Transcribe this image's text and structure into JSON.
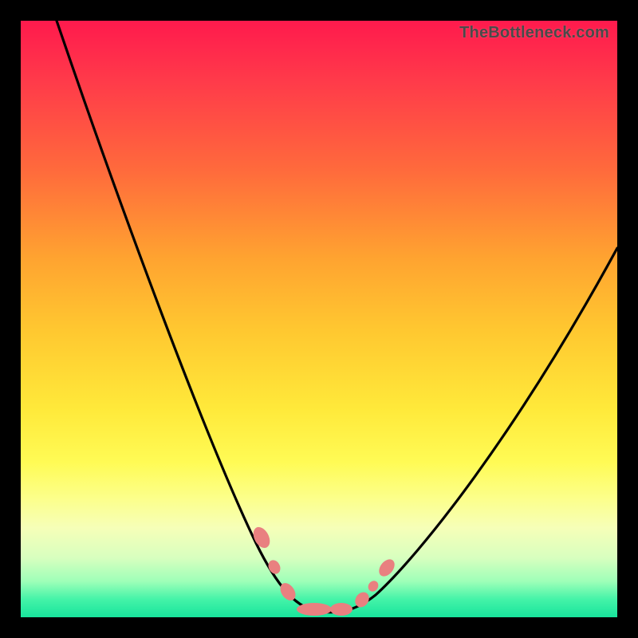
{
  "watermark": {
    "text": "TheBottleneck.com"
  },
  "chart_data": {
    "type": "line",
    "title": "",
    "xlabel": "",
    "ylabel": "",
    "xlim": [
      0,
      100
    ],
    "ylim": [
      0,
      100
    ],
    "grid": false,
    "legend": false,
    "series": [
      {
        "name": "bottleneck-curve",
        "x": [
          6,
          12,
          18,
          24,
          30,
          36,
          40,
          44,
          47,
          49,
          51,
          53,
          55,
          58,
          62,
          68,
          76,
          86,
          96,
          100
        ],
        "values": [
          100,
          84,
          68,
          52,
          36,
          22,
          13,
          6,
          2,
          0,
          0,
          0,
          1,
          4,
          9,
          17,
          29,
          44,
          57,
          62
        ]
      },
      {
        "name": "bottleneck-markers",
        "x": [
          40,
          44,
          47,
          49,
          53,
          56,
          58,
          61
        ],
        "values": [
          12,
          5,
          2,
          0,
          0,
          2,
          4,
          7
        ]
      }
    ],
    "colors": {
      "curve": "#000000",
      "marker_fill": "#e98080",
      "marker_stroke": "#c95858",
      "gradient_top": "#ff1a4d",
      "gradient_bottom": "#18e49c"
    }
  }
}
